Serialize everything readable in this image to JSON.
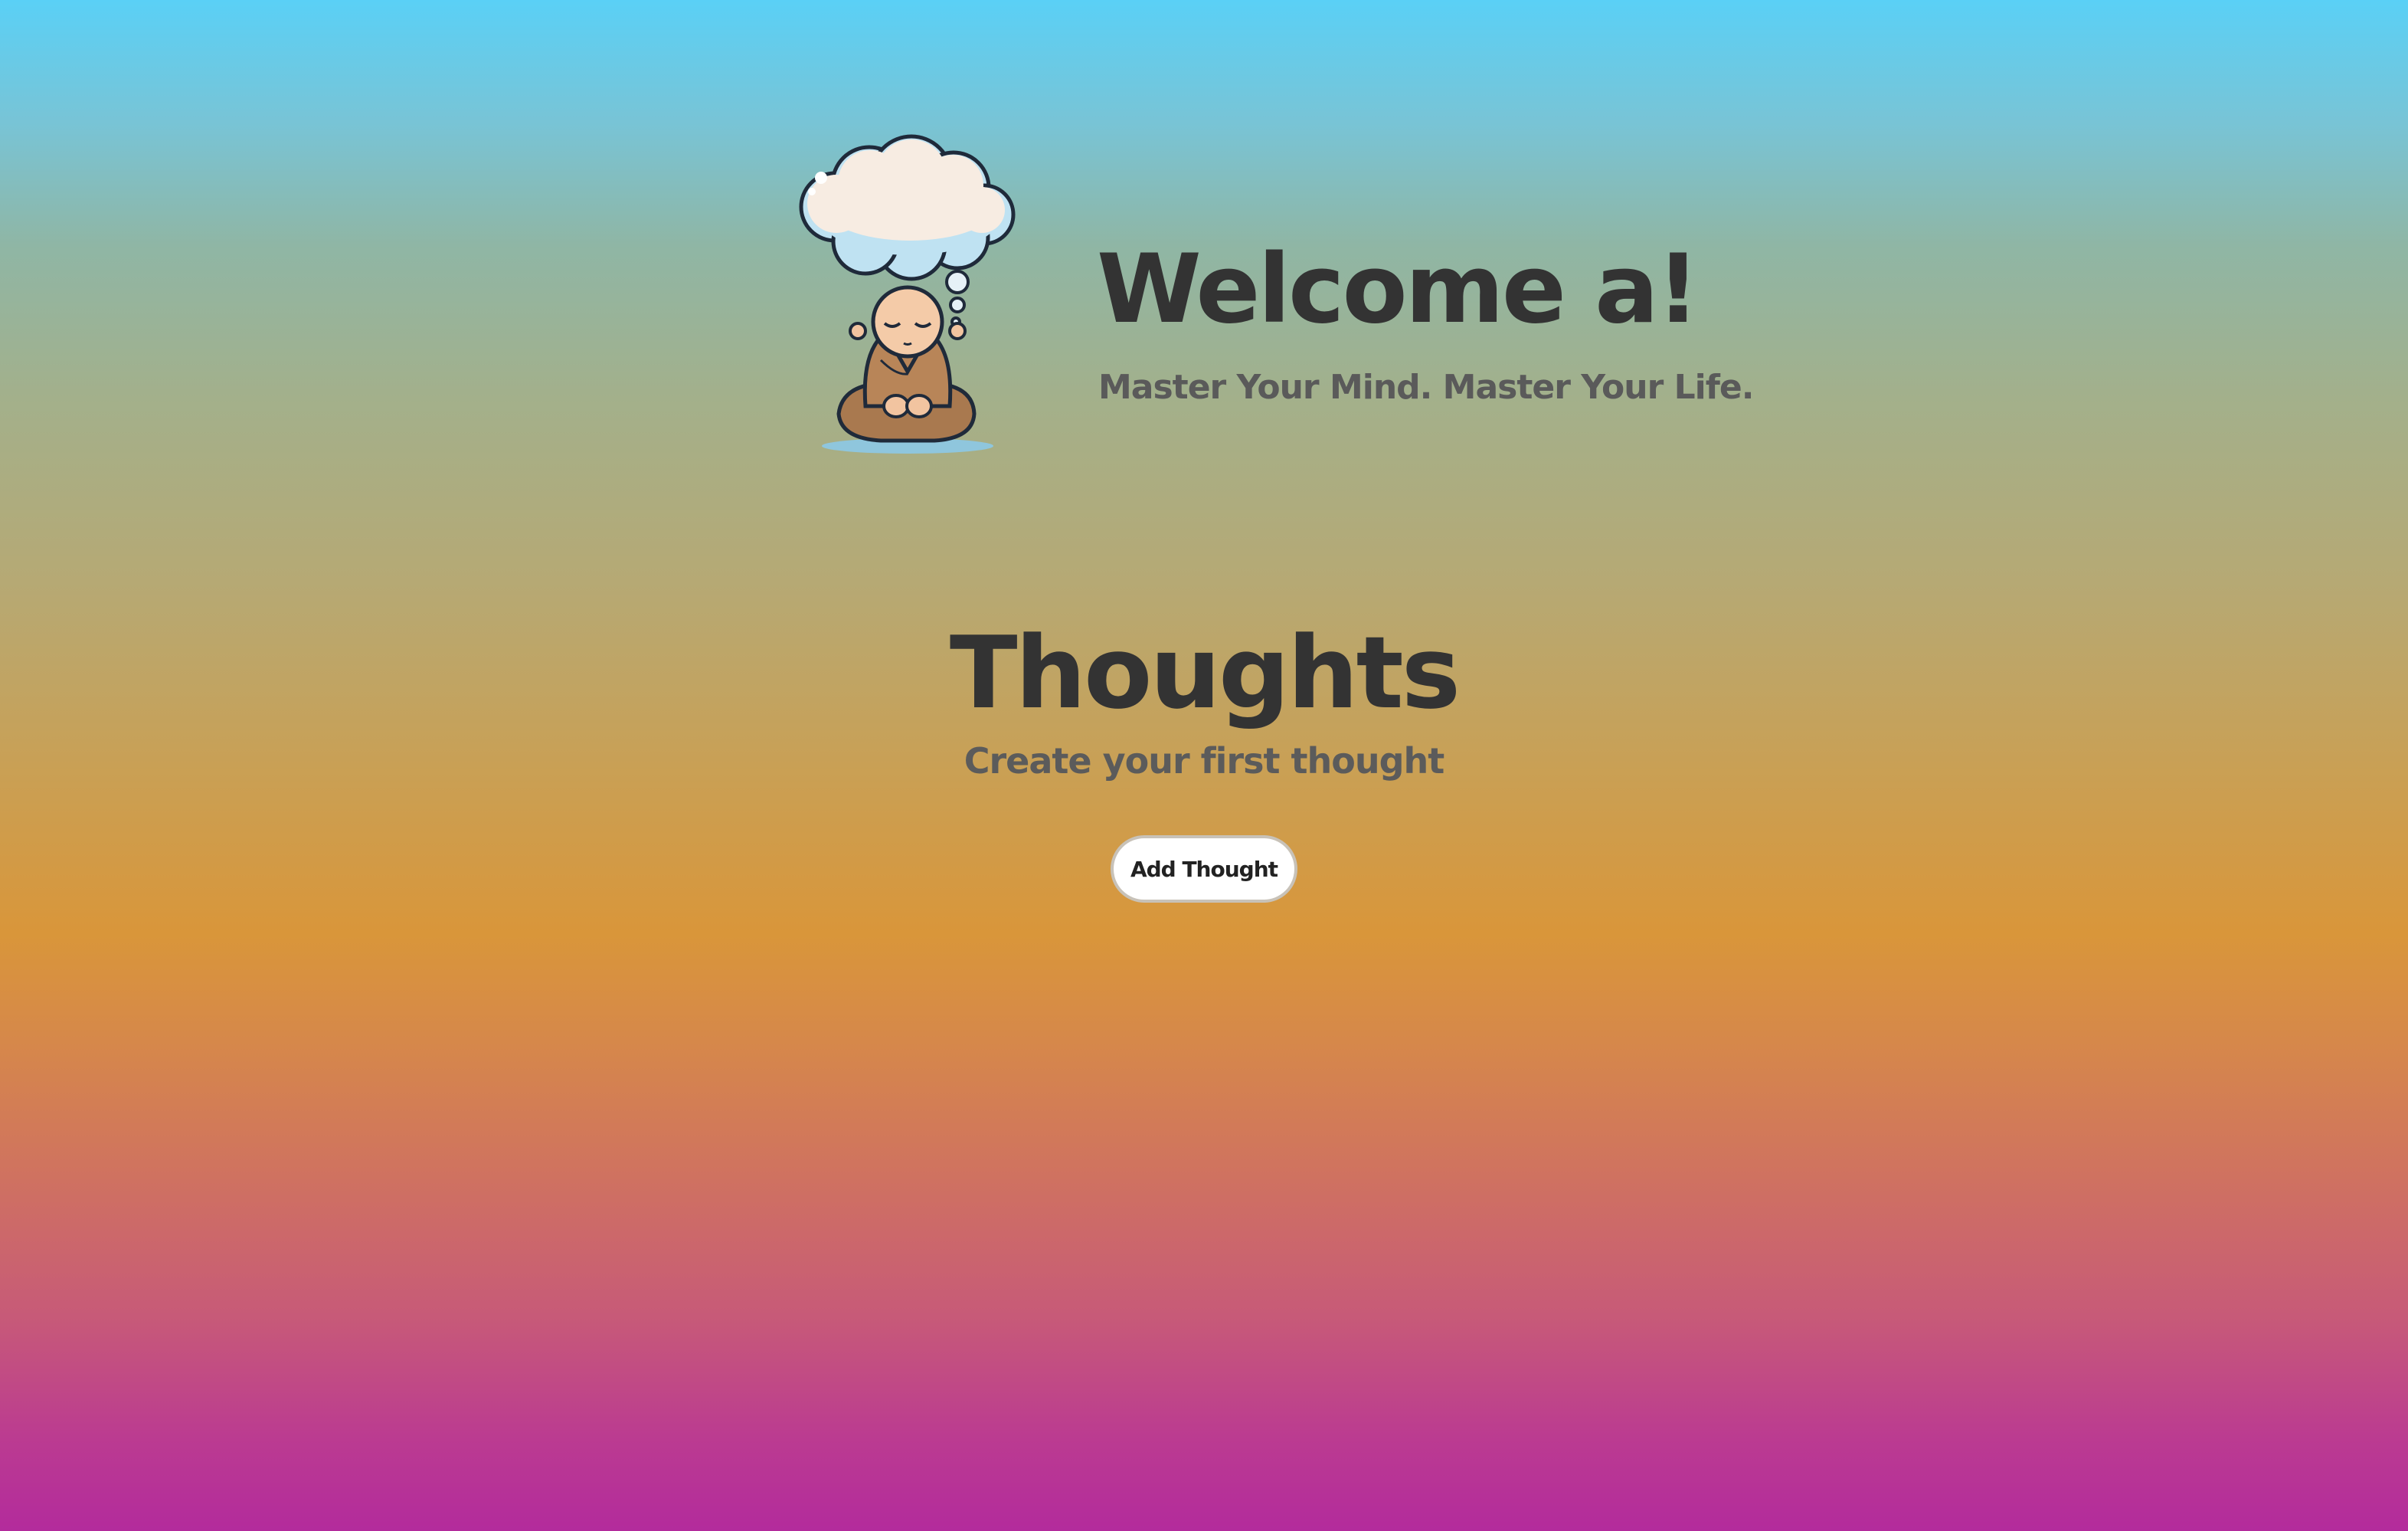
{
  "hero": {
    "welcome_title": "Welcome a!",
    "tagline": "Master Your Mind. Master Your Life.",
    "mascot_icon": "meditating-monk-thought-cloud-icon"
  },
  "thoughts": {
    "title": "Thoughts",
    "empty_message": "Create your first thought",
    "add_button_label": "Add Thought"
  },
  "colors": {
    "background_top": "#5ad0f6",
    "background_middle": "#d9963a",
    "background_bottom": "#b32b9c",
    "heading_text": "#333333",
    "subtext": "#5a5a5a"
  }
}
